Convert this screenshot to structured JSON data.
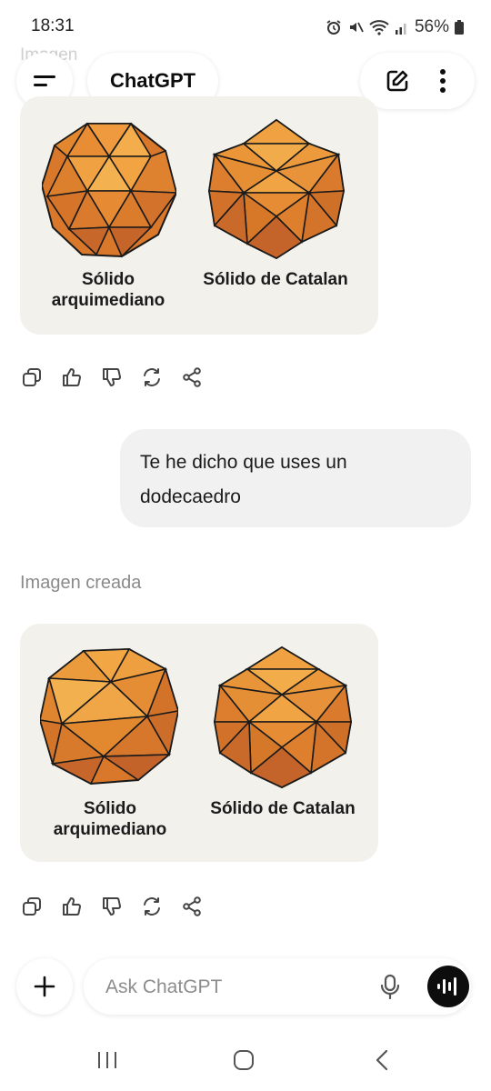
{
  "status": {
    "time": "18:31",
    "battery": "56%",
    "icons": [
      "alarm-icon",
      "mute-icon",
      "wifi-icon",
      "signal-icon",
      "battery-icon"
    ]
  },
  "header": {
    "faded_text": "Imagen ",
    "title": "ChatGPT",
    "menu_icon": "menu-icon",
    "new_chat_icon": "edit-icon",
    "more_icon": "more-vertical-icon"
  },
  "conversation": {
    "image1": {
      "left_label": "Sólido arquimediano",
      "right_label": "Sólido de Catalan"
    },
    "user_message": "Te he dicho que uses un dodecaedro",
    "section_label": "Imagen creada",
    "image2": {
      "left_label": "Sólido arquimediano",
      "right_label": "Sólido de Catalan"
    },
    "actions": [
      "copy-icon",
      "thumbs-up-icon",
      "thumbs-down-icon",
      "regenerate-icon",
      "share-icon"
    ]
  },
  "composer": {
    "placeholder": "Ask ChatGPT",
    "plus_icon": "plus-icon",
    "mic_icon": "mic-icon",
    "voice_icon": "voice-mode-icon"
  },
  "navbar": {
    "icons": [
      "recent-apps-icon",
      "home-icon",
      "back-icon"
    ]
  },
  "colors": {
    "accent": "#0d0d0d",
    "solid_orange": "#e08a2c",
    "card_bg": "#f3f1ec",
    "bubble_bg": "#f1f1f1"
  }
}
